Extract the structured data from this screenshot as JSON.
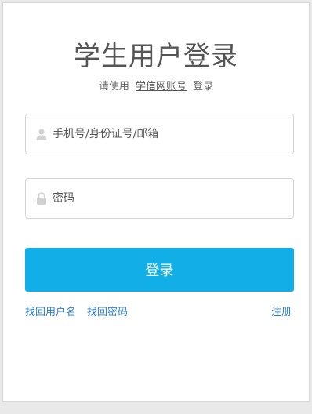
{
  "header": {
    "title": "学生用户登录",
    "subtitle_prefix": "请使用",
    "subtitle_link": "学信网账号",
    "subtitle_suffix": "登录"
  },
  "form": {
    "username_placeholder": "手机号/身份证号/邮箱",
    "password_placeholder": "密码",
    "login_label": "登录"
  },
  "links": {
    "find_username": "找回用户名",
    "find_password": "找回密码",
    "register": "注册"
  },
  "colors": {
    "primary_button": "#11aee8",
    "link": "#2b7fd3"
  }
}
